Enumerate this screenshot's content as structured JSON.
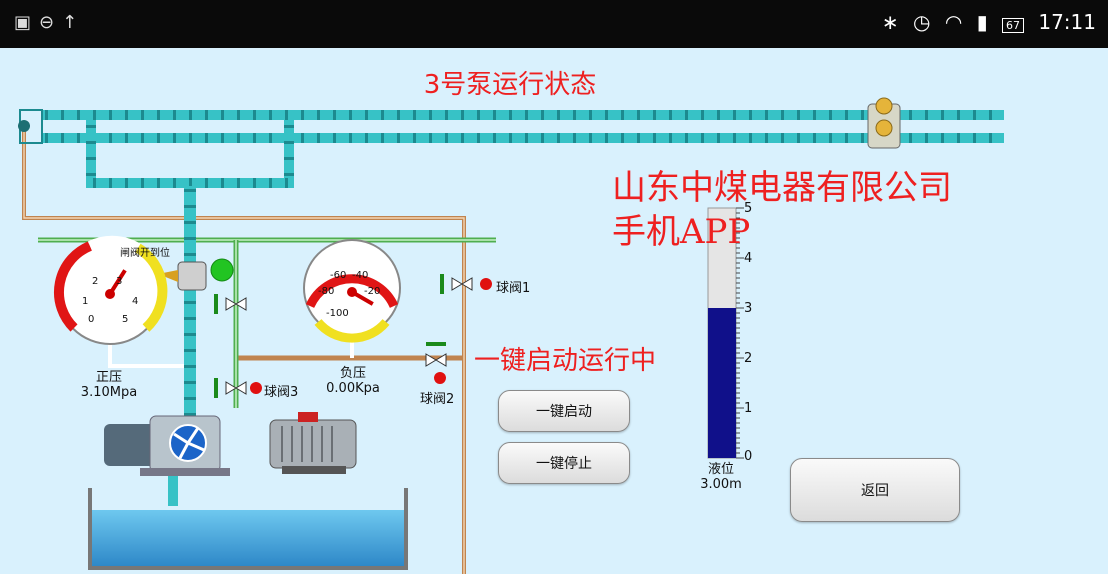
{
  "status_bar": {
    "left_icons": [
      "image-icon",
      "lock-icon",
      "upload-icon"
    ],
    "time": "17:11",
    "battery": "67",
    "right_icons": [
      "bluetooth-icon",
      "alarm-icon",
      "wifi-icon",
      "signal-icon",
      "battery-icon"
    ]
  },
  "page": {
    "title": "3号泵运行状态",
    "company_line1": "山东中煤电器有限公司",
    "company_line2": "手机APP",
    "running_status": "一键启动运行中"
  },
  "gauges": {
    "positive": {
      "label": "正压",
      "value": "3.10Mpa",
      "ticks": [
        "0",
        "1",
        "2",
        "3",
        "4",
        "5"
      ],
      "reading": 3.1
    },
    "negative": {
      "label": "负压",
      "value": "0.00Kpa",
      "ticks": [
        "-100",
        "-80",
        "-60",
        "-40",
        "-20"
      ],
      "reading": 0
    }
  },
  "valves": {
    "gate_valve_label": "闸阀开到位",
    "ball_valve_1": "球阀1",
    "ball_valve_2": "球阀2",
    "ball_valve_3": "球阀3"
  },
  "level": {
    "label": "液位",
    "value": "3.00m",
    "ticks": [
      "5",
      "4",
      "3",
      "2",
      "1",
      "0"
    ],
    "fill_fraction": 0.6
  },
  "buttons": {
    "start": "一键启动",
    "stop": "一键停止",
    "back": "返回"
  },
  "colors": {
    "title_red": "#ee2020",
    "pipe_cyan": "#37c2c6",
    "level_blue": "#10108a"
  }
}
